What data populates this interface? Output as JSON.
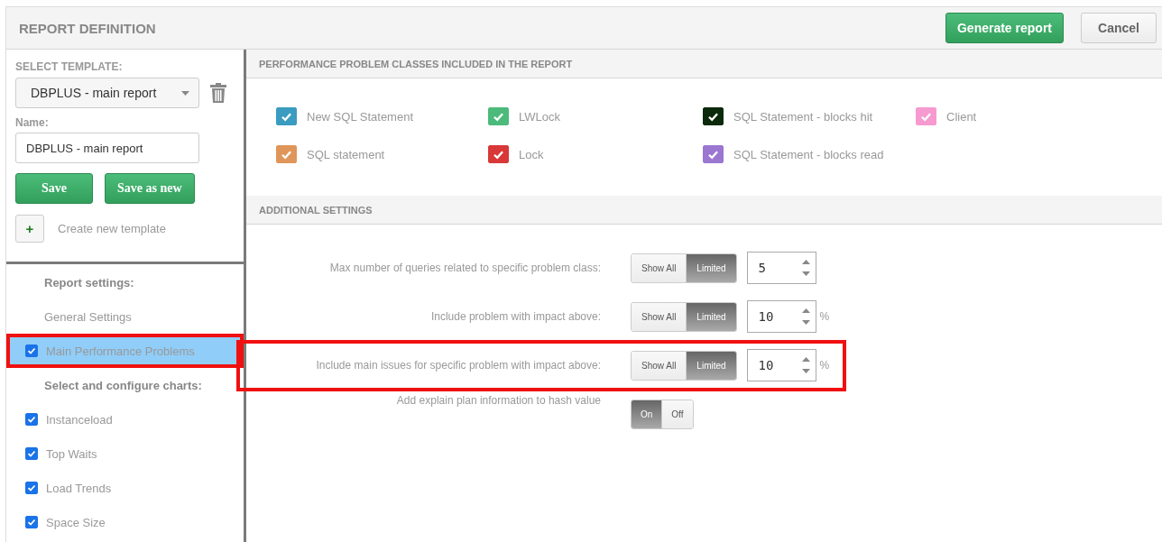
{
  "header": {
    "title": "REPORT DEFINITION",
    "buttons": [
      {
        "label": "Generate report",
        "kind": "primary"
      },
      {
        "label": "Cancel",
        "kind": "default"
      }
    ]
  },
  "template": {
    "label": "SELECT TEMPLATE:",
    "value": "DBPLUS - main report",
    "name_label": "Name:",
    "name_value": "DBPLUS - main report",
    "buttons": [
      "Save",
      "Save as new"
    ],
    "create_icon": "+",
    "create_label": "Create new template"
  },
  "nav": [
    {
      "kind": "heading",
      "label": "Report settings:"
    },
    {
      "kind": "link",
      "label": "General Settings",
      "selected": false,
      "highlighted": false
    },
    {
      "kind": "check",
      "label": "Main Performance Problems",
      "checked": true,
      "selected": true,
      "highlighted": true
    },
    {
      "kind": "heading",
      "label": "Select and configure charts:"
    },
    {
      "kind": "check",
      "label": "Instanceload",
      "checked": true,
      "selected": false,
      "highlighted": false
    },
    {
      "kind": "check",
      "label": "Top Waits",
      "checked": true,
      "selected": false,
      "highlighted": false
    },
    {
      "kind": "check",
      "label": "Load Trends",
      "checked": true,
      "selected": false,
      "highlighted": false
    },
    {
      "kind": "check",
      "label": "Space Size",
      "checked": true,
      "selected": false,
      "highlighted": false
    }
  ],
  "classes": {
    "title": "PERFORMANCE PROBLEM CLASSES INCLUDED IN THE REPORT",
    "items": [
      {
        "label": "New SQL Statement",
        "color": "#3a9cc0",
        "checked": true
      },
      {
        "label": "LWLock",
        "color": "#4cba7a",
        "checked": true
      },
      {
        "label": "SQL Statement - blocks hit",
        "color": "#0b2a0b",
        "checked": true
      },
      {
        "label": "Client",
        "color": "#f79ad0",
        "checked": true
      },
      {
        "label": "SQL statement",
        "color": "#e0965a",
        "checked": true
      },
      {
        "label": "Lock",
        "color": "#d93838",
        "checked": true
      },
      {
        "label": "SQL Statement - blocks read",
        "color": "#9b77d1",
        "checked": true
      }
    ]
  },
  "settings": {
    "title": "ADDITIONAL SETTINGS",
    "rows": [
      {
        "label": "Max number of queries related to specific problem class:",
        "kind": "limit",
        "options": [
          {
            "label": "Show All",
            "selected": false
          },
          {
            "label": "Limited",
            "selected": true
          }
        ],
        "value": "5",
        "highlighted": false
      },
      {
        "label": "Include problem with impact above:",
        "kind": "limit",
        "options": [
          {
            "label": "Show All",
            "selected": false
          },
          {
            "label": "Limited",
            "selected": true
          }
        ],
        "value": "10",
        "unit": "%",
        "highlighted": false
      },
      {
        "label": "Include main issues for specific problem with impact above:",
        "kind": "limit",
        "options": [
          {
            "label": "Show All",
            "selected": false
          },
          {
            "label": "Limited",
            "selected": true
          }
        ],
        "value": "10",
        "unit": "%",
        "highlighted": true
      },
      {
        "label": "Add explain plan information to hash value",
        "kind": "toggle",
        "options": [
          {
            "label": "On",
            "selected": true
          },
          {
            "label": "Off",
            "selected": false
          }
        ],
        "highlighted": false
      }
    ]
  }
}
